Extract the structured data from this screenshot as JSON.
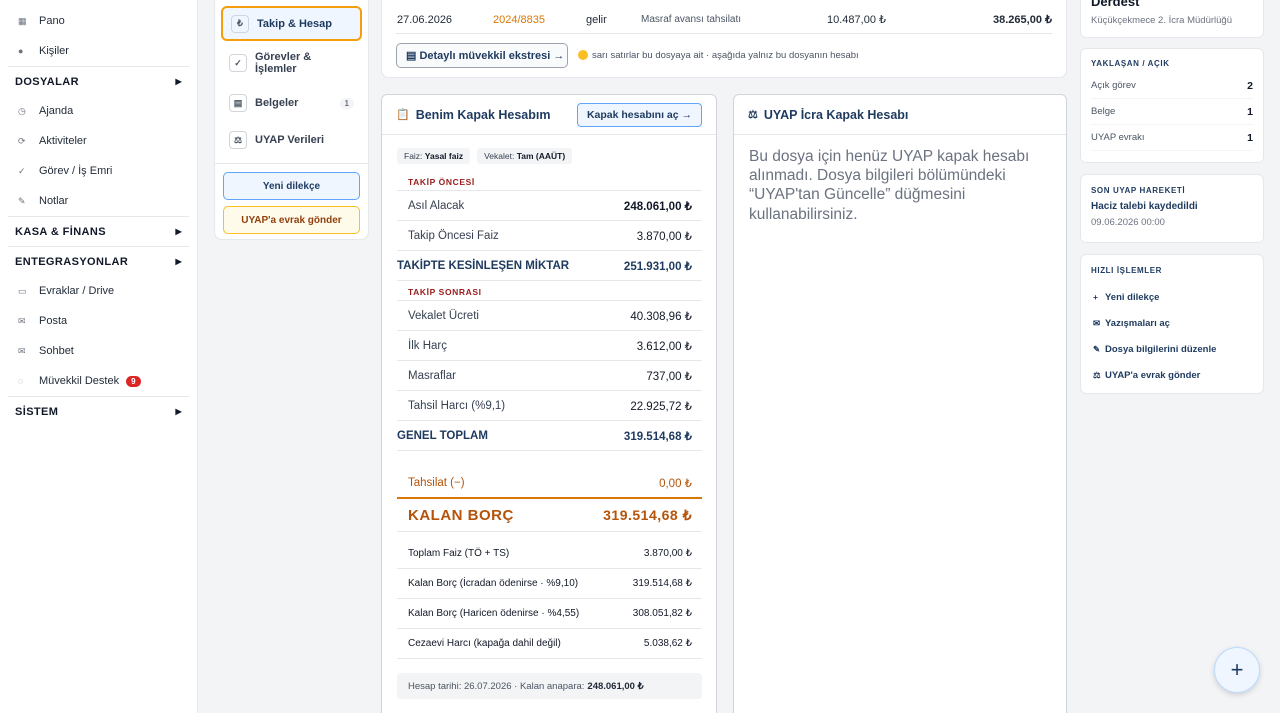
{
  "sidebar": {
    "items_top": [
      {
        "icon": "grid-icon",
        "glyph": "▦",
        "label": "Pano"
      },
      {
        "icon": "person-icon",
        "glyph": "●",
        "label": "Kişiler"
      }
    ],
    "section_dosyalar": "DOSYALAR",
    "items_dosyalar": [
      {
        "icon": "clock-icon",
        "glyph": "◷",
        "label": "Ajanda"
      },
      {
        "icon": "activity-icon",
        "glyph": "⟳",
        "label": "Aktiviteler"
      },
      {
        "icon": "check-icon",
        "glyph": "✓",
        "label": "Görev / İş Emri"
      },
      {
        "icon": "pencil-icon",
        "glyph": "✎",
        "label": "Notlar"
      }
    ],
    "section_kasa": "KASA & FİNANS",
    "section_entegrasyon": "ENTEGRASYONLAR",
    "items_entegrasyon": [
      {
        "icon": "folder-icon",
        "glyph": "▭",
        "label": "Evraklar / Drive"
      },
      {
        "icon": "mail-icon",
        "glyph": "✉",
        "label": "Posta"
      },
      {
        "icon": "chat-icon",
        "glyph": "✉",
        "label": "Sohbet"
      },
      {
        "icon": "support-icon",
        "glyph": "◌",
        "label": "Müvekkil Destek",
        "badge": "9"
      }
    ],
    "section_sistem": "SİSTEM",
    "arrow": "▶"
  },
  "subnav": {
    "items": [
      {
        "glyph": "₺",
        "label": "Takip & Hesap"
      },
      {
        "glyph": "✓",
        "label": "Görevler & İşlemler"
      },
      {
        "glyph": "▤",
        "label": "Belgeler",
        "count": "1"
      },
      {
        "glyph": "⚖",
        "label": "UYAP Verileri"
      }
    ],
    "btn_dilekce": "Yeni dilekçe",
    "btn_uyap": "UYAP'a evrak gönder"
  },
  "topstrip": {
    "row": {
      "date": "27.06.2026",
      "file_no": "2024/8835",
      "type": "gelir",
      "desc": "Masraf avansı tahsilatı",
      "amount": "10.487,00 ₺",
      "balance": "38.265,00 ₺"
    },
    "btn_ekstre": "▤ Detaylı müvekkil ekstresi →",
    "note": "sarı satırlar bu dosyaya ait · aşağıda yalnız bu dosyanın hesabı"
  },
  "left_panel": {
    "icon": "📋",
    "title": "Benim Kapak Hesabım",
    "btn": "Kapak hesabını aç →",
    "chip_faiz_label": "Faiz:",
    "chip_faiz_value": "Yasal faiz",
    "chip_vekalet_label": "Vekalet:",
    "chip_vekalet_value": "Tam (AAÜT)",
    "sec_oncesi": "TAKİP ÖNCESİ",
    "asil_alacak": {
      "label": "Asıl Alacak",
      "value": "248.061,00 ₺"
    },
    "takip_oncesi_faiz": {
      "label": "Takip Öncesi Faiz",
      "value": "3.870,00 ₺"
    },
    "kesinlesen": {
      "label": "TAKİPTE KESİNLEŞEN MİKTAR",
      "value": "251.931,00 ₺"
    },
    "sec_sonrasi": "TAKİP SONRASI",
    "vekalet": {
      "label": "Vekalet Ücreti",
      "value": "40.308,96 ₺"
    },
    "ilk_harc": {
      "label": "İlk Harç",
      "value": "3.612,00 ₺"
    },
    "masraflar": {
      "label": "Masraflar",
      "value": "737,00 ₺"
    },
    "tahsil_harci": {
      "label": "Tahsil Harcı (%9,1)",
      "value": "22.925,72 ₺"
    },
    "genel_toplam": {
      "label": "GENEL TOPLAM",
      "value": "319.514,68 ₺"
    },
    "tahsilat": {
      "label": "Tahsilat (−)",
      "value": "0,00 ₺"
    },
    "kalan_borc": {
      "label": "KALAN BORÇ",
      "value": "319.514,68 ₺"
    },
    "toplam_faiz": {
      "label": "Toplam Faiz (TÖ + TS)",
      "value": "3.870,00 ₺"
    },
    "kalan_icradan": {
      "label": "Kalan Borç (İcradan ödenirse · %9,10)",
      "value": "319.514,68 ₺"
    },
    "kalan_haricen": {
      "label": "Kalan Borç (Haricen ödenirse · %4,55)",
      "value": "308.051,82 ₺"
    },
    "cezaevi": {
      "label": "Cezaevi Harcı (kapağa dahil değil)",
      "value": "5.038,62 ₺"
    },
    "foot_label": "Hesap tarihi: 26.07.2026 · Kalan anapara:",
    "foot_value": "248.061,00 ₺"
  },
  "right_panel": {
    "icon": "⚖",
    "title": "UYAP İcra Kapak Hesabı",
    "message": "Bu dosya için henüz UYAP kapak hesabı alınmadı. Dosya bilgileri bölümündeki “UYAP'tan Güncelle” düğmesini kullanabilirsiniz."
  },
  "right_column": {
    "top_title": "Derdest",
    "top_sub": "Küçükçekmece 2. İcra Müdürlüğü",
    "yaklasan_label": "YAKLAŞAN / AÇIK",
    "acik_gorev": {
      "label": "Açık görev",
      "value": "2"
    },
    "belge": {
      "label": "Belge",
      "value": "1"
    },
    "uyap_evraki": {
      "label": "UYAP evrakı",
      "value": "1"
    },
    "son_label": "SON UYAP HAREKETİ",
    "son_title": "Haciz talebi kaydedildi",
    "son_date": "09.06.2026 00:00",
    "hizli_label": "HIZLI İŞLEMLER",
    "quick": [
      {
        "glyph": "+",
        "label": "Yeni dilekçe"
      },
      {
        "glyph": "✉",
        "label": "Yazışmaları aç"
      },
      {
        "glyph": "✎",
        "label": "Dosya bilgilerini düzenle"
      },
      {
        "glyph": "⚖",
        "label": "UYAP'a evrak gönder"
      }
    ]
  },
  "fab": "+"
}
